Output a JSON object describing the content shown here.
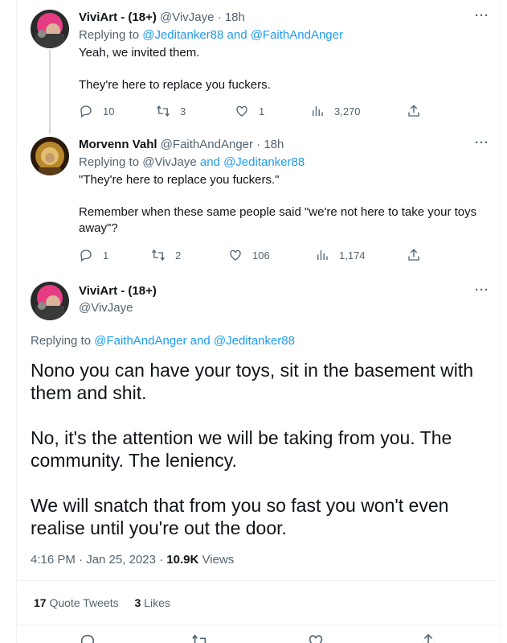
{
  "tweets": [
    {
      "name": "ViviArt - (18+)",
      "handle": "@VivJaye",
      "sep": " · ",
      "time": "18h",
      "replying_prefix": "Replying to ",
      "replying_users": "@Jeditanker88 and @FaithAndAnger",
      "body": "Yeah, we invited them.\n\nThey're here to replace you fuckers.",
      "replies": "10",
      "retweets": "3",
      "likes": "1",
      "views": "3,270",
      "more": "···"
    },
    {
      "name": "Morvenn Vahl",
      "handle": "@FaithAndAnger",
      "sep": " · ",
      "time": "18h",
      "replying_prefix": "Replying to ",
      "replying_user1": "@VivJaye",
      "replying_and": " and ",
      "replying_user2": "@Jeditanker88",
      "body": "\"They're here to replace you fuckers.\"\n\nRemember when these same people said \"we're not here to take your toys away\"?",
      "replies": "1",
      "retweets": "2",
      "likes": "106",
      "views": "1,174",
      "more": "···"
    }
  ],
  "main_tweet": {
    "name": "ViviArt - (18+)",
    "handle": "@VivJaye",
    "more": "···",
    "replying_prefix": "Replying to ",
    "replying_users": "@FaithAndAnger and @Jeditanker88",
    "body": "Nono you can have your toys, sit in the basement with them and shit.\n\nNo, it's the attention we will be taking from you. The community. The leniency.\n\nWe will snatch that from you so fast you won't even realise until you're out the door.",
    "timestamp": "4:16 PM · Jan 25, 2023 · ",
    "views_count": "10.9K",
    "views_label": " Views",
    "quote_count": "17",
    "quote_label": " Quote Tweets",
    "likes_count": "3",
    "likes_label": " Likes"
  },
  "colors": {
    "link": "#1d9bf0",
    "secondary": "#536471",
    "text": "#0f1419"
  }
}
